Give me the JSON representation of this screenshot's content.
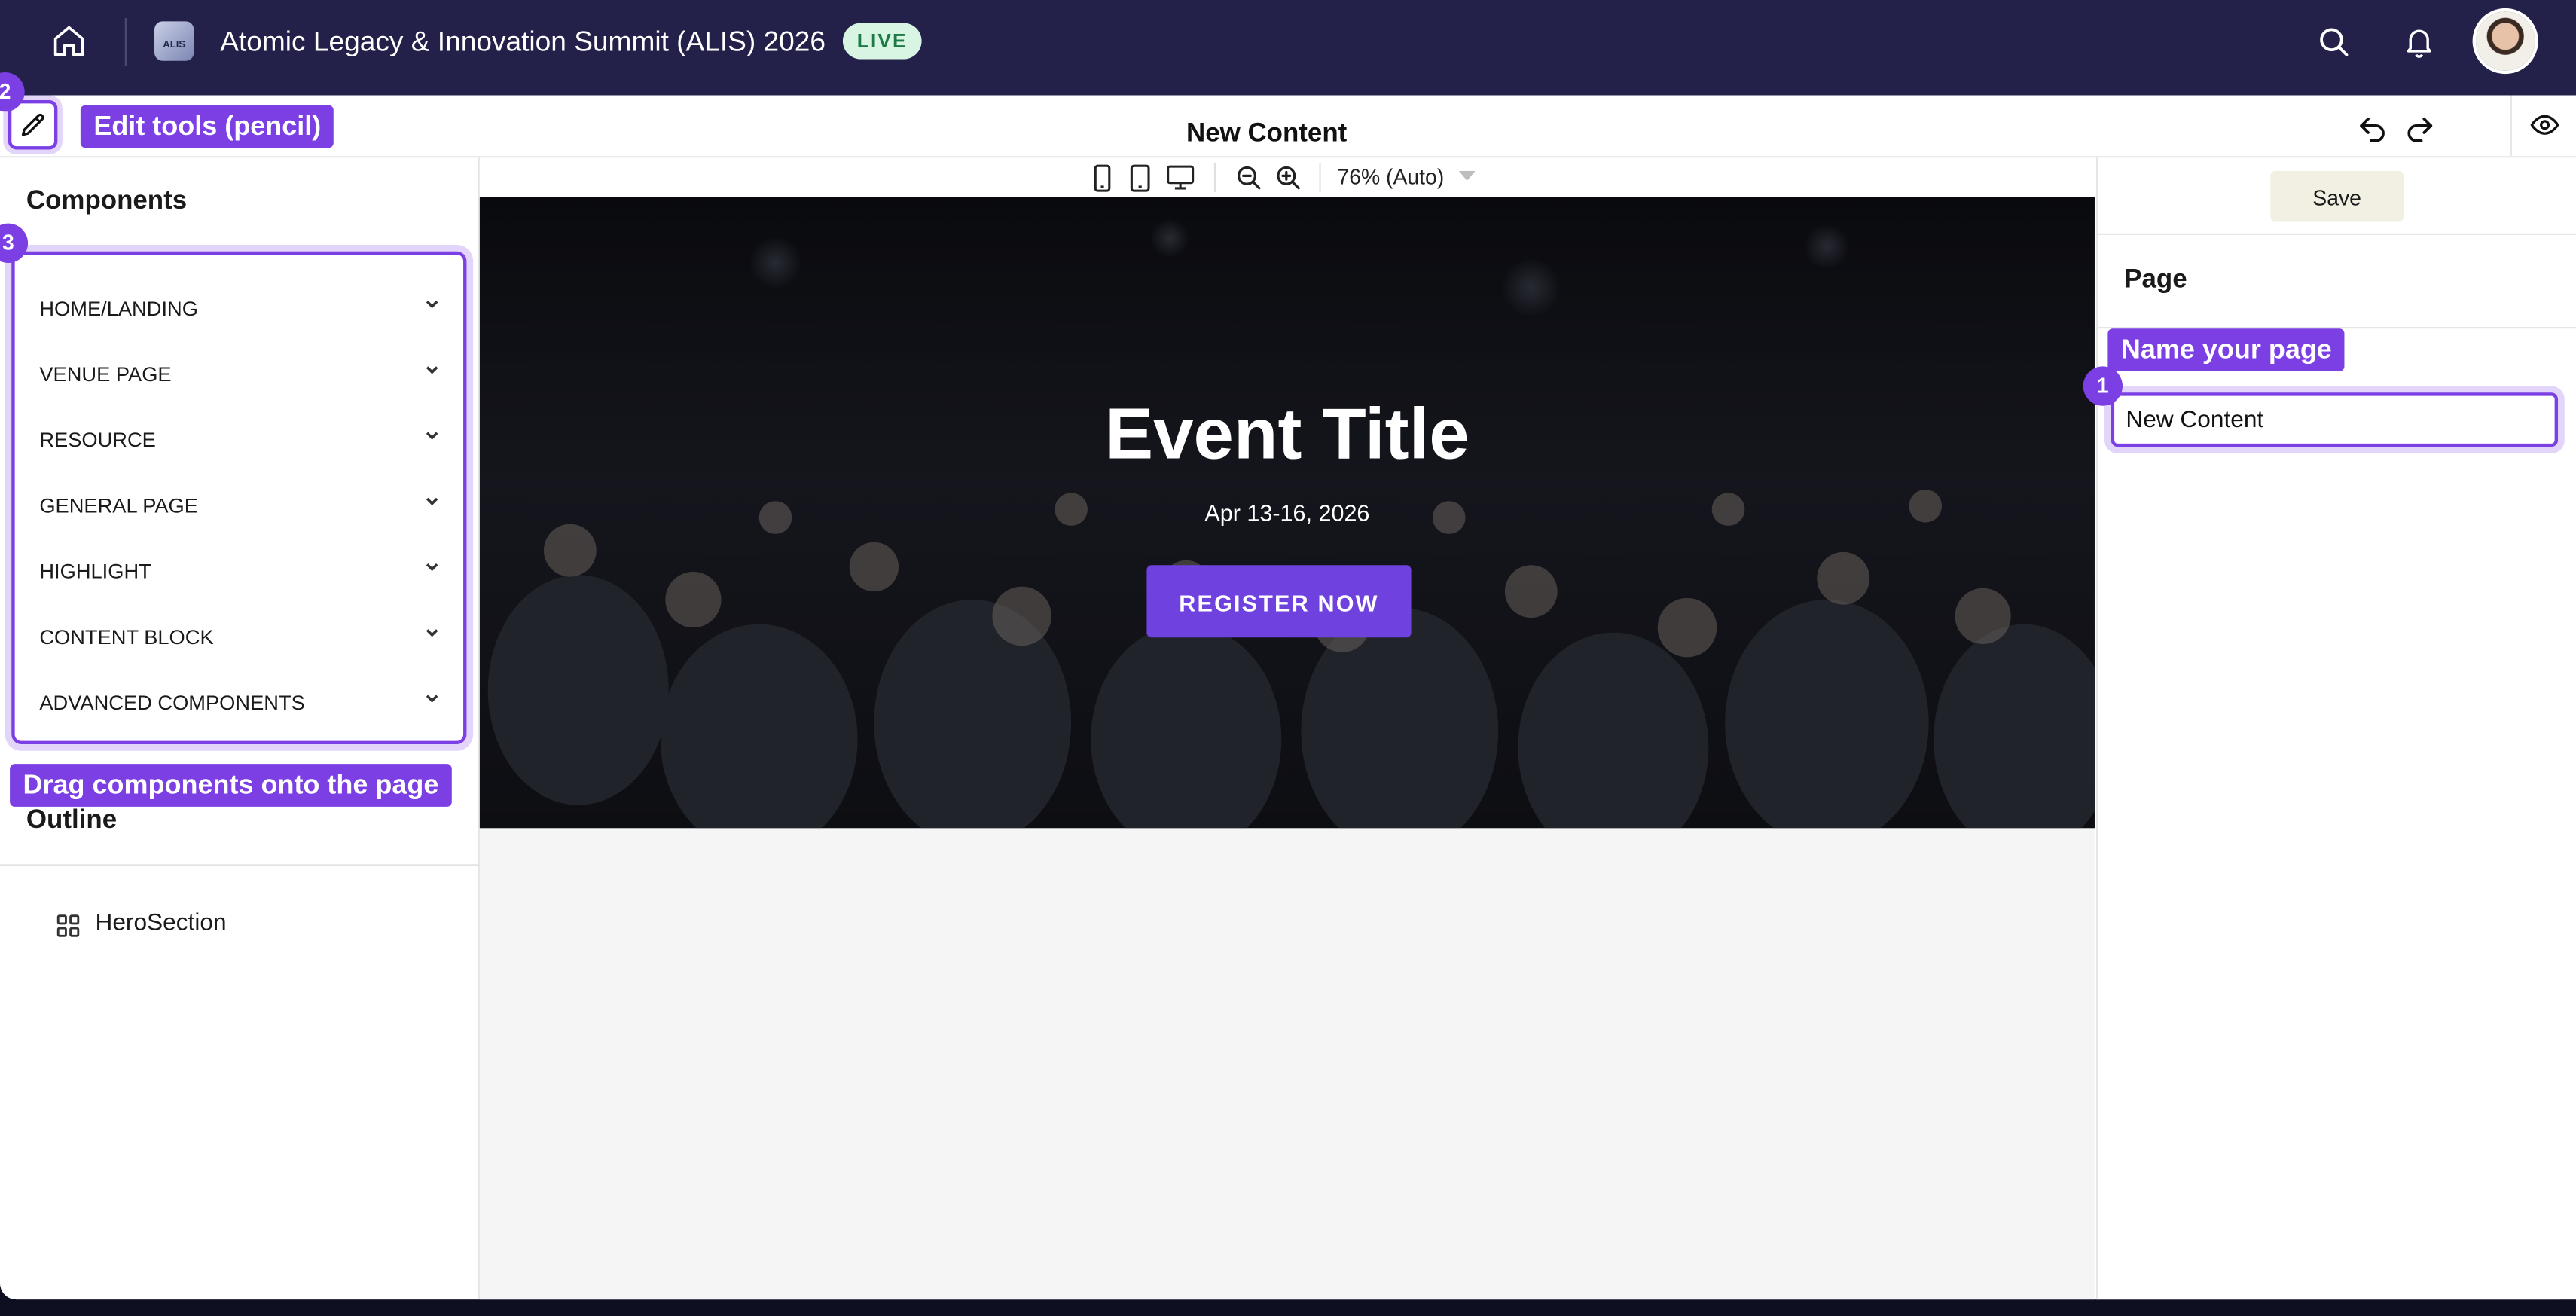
{
  "header": {
    "event_title": "Atomic Legacy & Innovation Summit (ALIS) 2026",
    "status_badge": "LIVE",
    "logo_text": "ALIS"
  },
  "toolbar": {
    "page_name": "New Content"
  },
  "viewport_bar": {
    "zoom_label": "76% (Auto)"
  },
  "components_panel": {
    "title": "Components",
    "items": [
      {
        "label": "HOME/LANDING"
      },
      {
        "label": "VENUE PAGE"
      },
      {
        "label": "RESOURCE"
      },
      {
        "label": "GENERAL PAGE"
      },
      {
        "label": "HIGHLIGHT"
      },
      {
        "label": "CONTENT BLOCK"
      },
      {
        "label": "ADVANCED COMPONENTS"
      }
    ]
  },
  "outline_panel": {
    "title": "Outline",
    "items": [
      {
        "label": "HeroSection"
      }
    ]
  },
  "hero": {
    "title": "Event Title",
    "date": "Apr 13-16, 2026",
    "button_label": "REGISTER NOW"
  },
  "settings_panel": {
    "save_label": "Save",
    "section_title": "Page",
    "page_name_value": "New Content"
  },
  "tutorial": {
    "steps": [
      {
        "number": "1",
        "text": "Name your page"
      },
      {
        "number": "2",
        "text": "Edit tools (pencil)"
      },
      {
        "number": "3",
        "text": "Drag components onto the page"
      }
    ]
  },
  "colors": {
    "header_bg": "#23214a",
    "accent": "#7b3fe4",
    "cta": "#6f42e0",
    "live_bg": "#d8f4e3",
    "live_text": "#1d7a46",
    "save_bg": "#f1f0e2"
  }
}
